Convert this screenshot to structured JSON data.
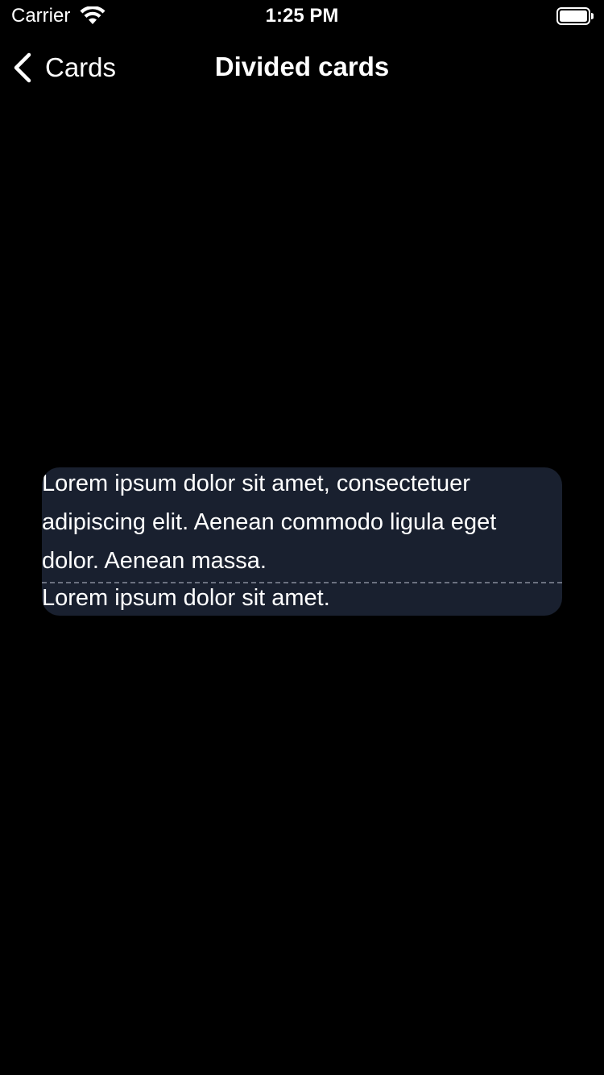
{
  "status_bar": {
    "carrier": "Carrier",
    "time": "1:25 PM",
    "wifi_icon": "wifi-icon",
    "battery_icon": "battery-full-icon"
  },
  "nav_bar": {
    "back_label": "Cards",
    "back_icon": "chevron-left-icon",
    "title": "Divided cards"
  },
  "card": {
    "sections": [
      {
        "text": "Lorem ipsum dolor sit amet, consectetuer adipiscing elit. Aenean commodo ligula eget dolor. Aenean massa."
      },
      {
        "text": "Lorem ipsum dolor sit amet."
      }
    ],
    "divider_style": "dashed"
  },
  "colors": {
    "background": "#000000",
    "card_background": "#19202f",
    "text": "#ffffff",
    "divider": "#6b7180"
  }
}
